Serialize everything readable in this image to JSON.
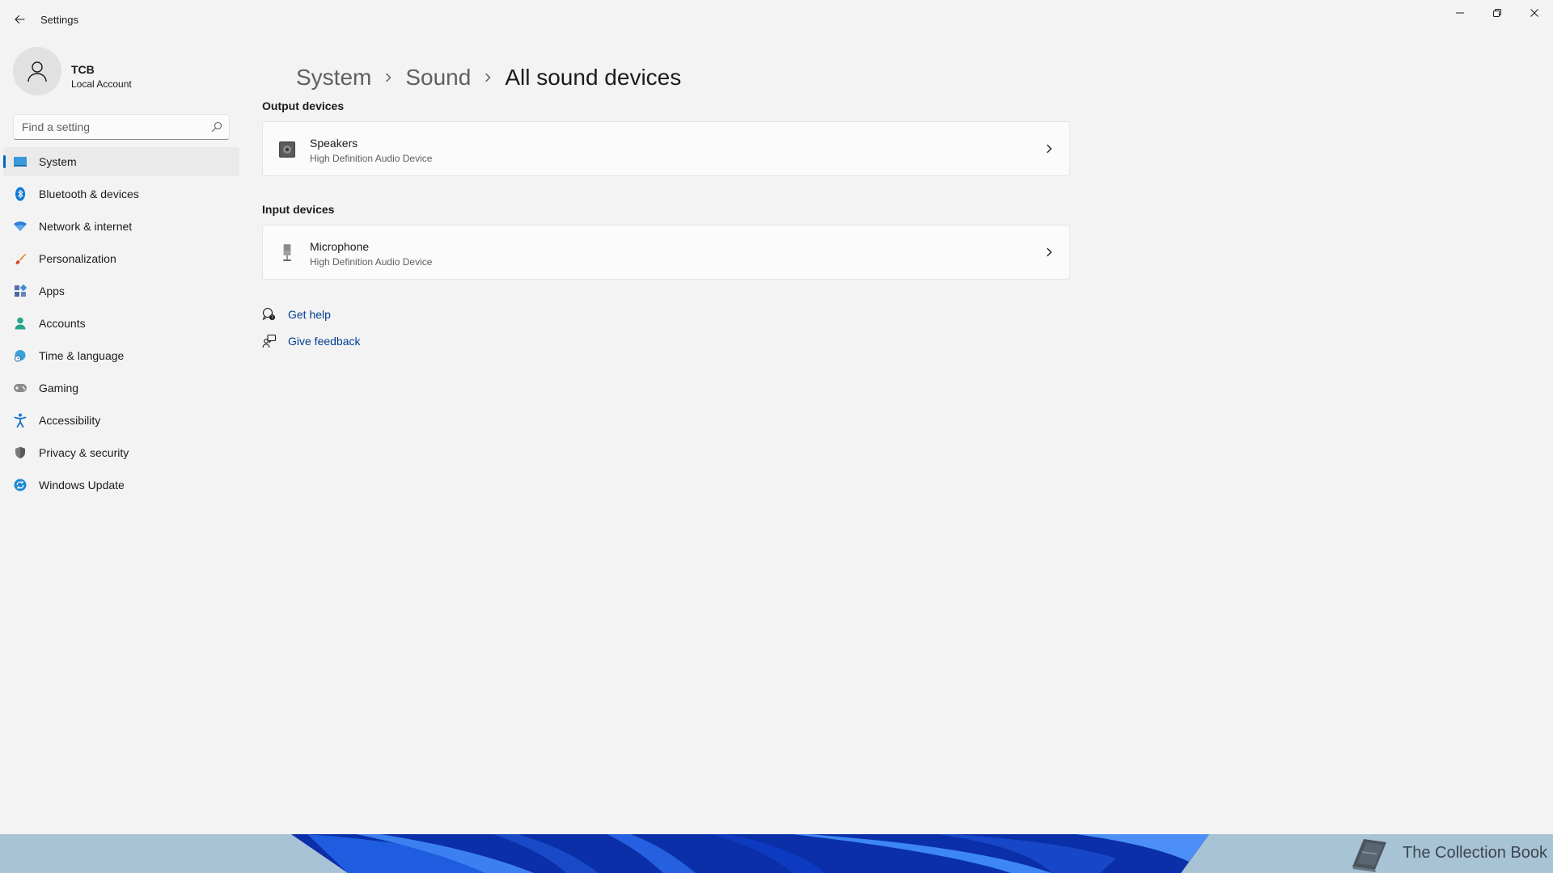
{
  "window": {
    "app_title": "Settings",
    "controls": [
      "minimize",
      "restore",
      "close"
    ]
  },
  "user": {
    "name": "TCB",
    "account_type": "Local Account"
  },
  "search": {
    "placeholder": "Find a setting"
  },
  "sidebar": {
    "items": [
      {
        "label": "System",
        "icon": "system-icon",
        "selected": true
      },
      {
        "label": "Bluetooth & devices",
        "icon": "bluetooth-icon"
      },
      {
        "label": "Network & internet",
        "icon": "wifi-icon"
      },
      {
        "label": "Personalization",
        "icon": "brush-icon"
      },
      {
        "label": "Apps",
        "icon": "apps-icon"
      },
      {
        "label": "Accounts",
        "icon": "person-icon"
      },
      {
        "label": "Time & language",
        "icon": "globe-clock-icon"
      },
      {
        "label": "Gaming",
        "icon": "gamepad-icon"
      },
      {
        "label": "Accessibility",
        "icon": "accessibility-icon"
      },
      {
        "label": "Privacy & security",
        "icon": "shield-icon"
      },
      {
        "label": "Windows Update",
        "icon": "update-icon"
      }
    ]
  },
  "breadcrumb": {
    "items": [
      "System",
      "Sound",
      "All sound devices"
    ]
  },
  "output": {
    "title": "Output devices",
    "devices": [
      {
        "name": "Speakers",
        "description": "High Definition Audio Device",
        "icon": "speaker-icon"
      }
    ]
  },
  "input": {
    "title": "Input devices",
    "devices": [
      {
        "name": "Microphone",
        "description": "High Definition Audio Device",
        "icon": "microphone-icon"
      }
    ]
  },
  "links": {
    "help": "Get help",
    "feedback": "Give feedback"
  },
  "taskbar": {
    "brand_text": "The Collection Book"
  },
  "colors": {
    "accent": "#0067c0",
    "link": "#003e92",
    "background": "#f3f3f3",
    "card": "#fbfbfb"
  }
}
